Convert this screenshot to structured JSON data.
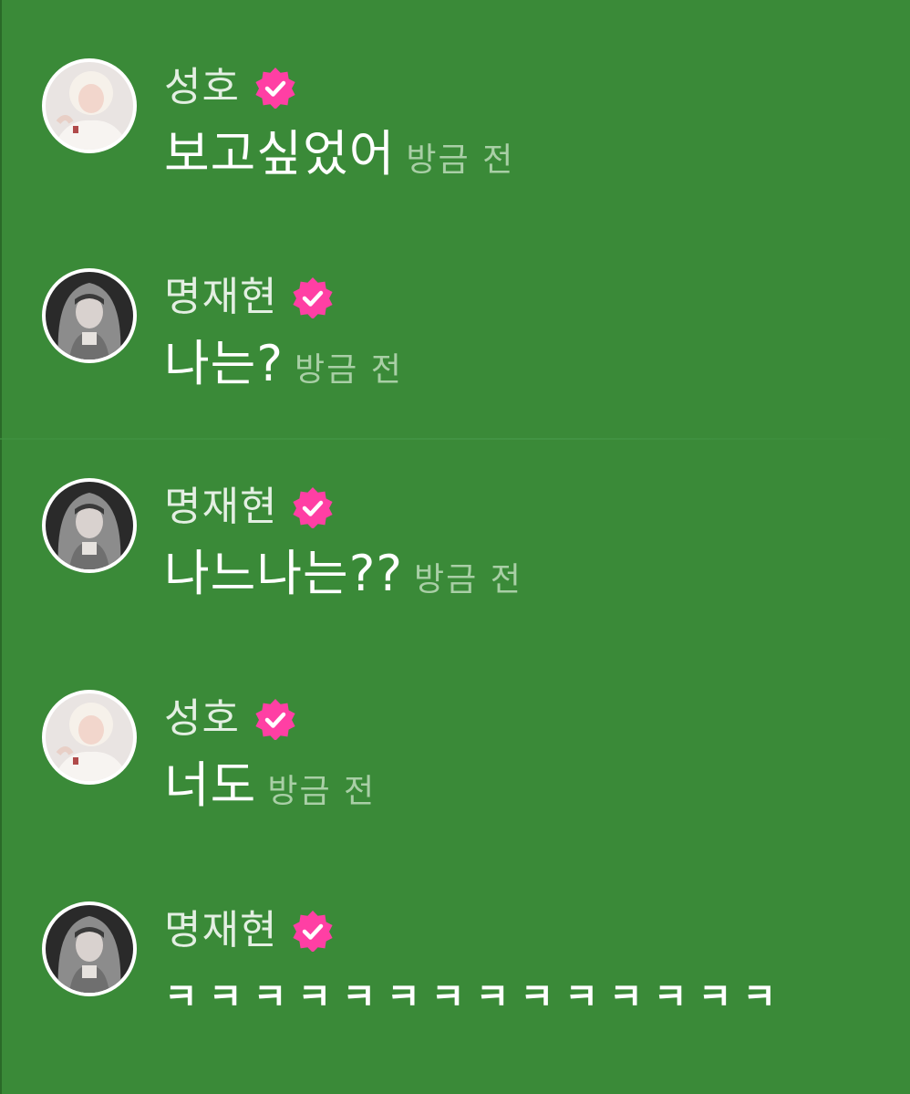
{
  "messages": [
    {
      "name": "성호",
      "avatar": "avatar-seongho",
      "text": "보고싶었어",
      "time": "방금 전"
    },
    {
      "name": "명재현",
      "avatar": "avatar-myungjaehyun",
      "text": "나는?",
      "time": "방금 전"
    },
    {
      "name": "명재현",
      "avatar": "avatar-myungjaehyun",
      "text": "나느나는??",
      "time": "방금 전"
    },
    {
      "name": "성호",
      "avatar": "avatar-seongho",
      "text": "너도",
      "time": "방금 전"
    },
    {
      "name": "명재현",
      "avatar": "avatar-myungjaehyun",
      "text": "ㅋㅋㅋㅋㅋㅋㅋㅋㅋㅋㅋㅋㅋㅋ",
      "time": ""
    }
  ],
  "colors": {
    "background": "#3a8a38",
    "badge": "#ff3fa4",
    "name": "#e3efe2",
    "text": "#ffffff",
    "time": "#a9cfa6"
  },
  "icons": {
    "verified_badge": "verified-badge-icon"
  }
}
